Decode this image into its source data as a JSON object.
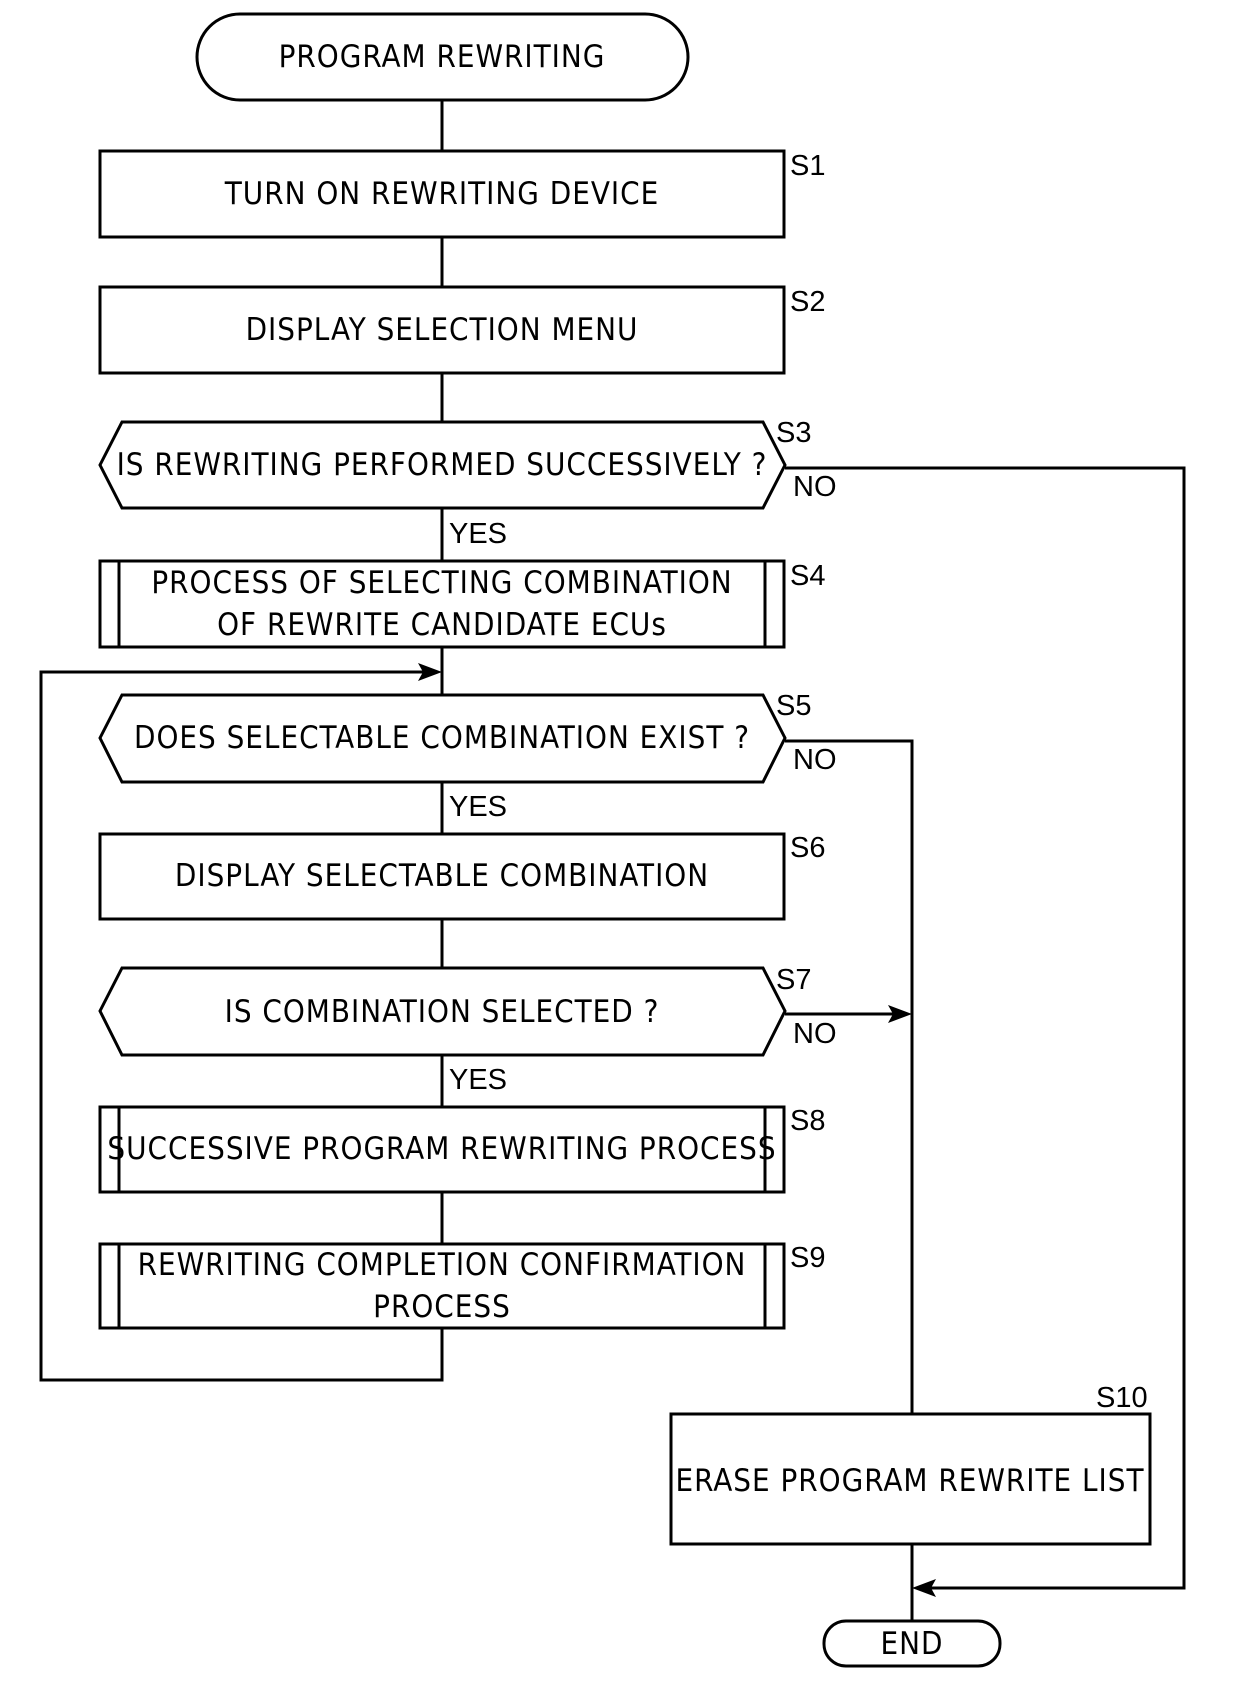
{
  "title": "PROGRAM REWRITING",
  "end_label": "END",
  "branch_labels": {
    "yes": "YES",
    "no": "NO"
  },
  "steps": {
    "s1": {
      "id": "S1",
      "text": "TURN ON REWRITING DEVICE",
      "type": "process"
    },
    "s2": {
      "id": "S2",
      "text": "DISPLAY SELECTION MENU",
      "type": "process"
    },
    "s3": {
      "id": "S3",
      "text": "IS REWRITING PERFORMED SUCCESSIVELY ?",
      "type": "decision"
    },
    "s4": {
      "id": "S4",
      "line1": "PROCESS OF SELECTING COMBINATION",
      "line2": "OF REWRITE CANDIDATE ECUs",
      "type": "subprocess"
    },
    "s5": {
      "id": "S5",
      "text": "DOES SELECTABLE COMBINATION EXIST ?",
      "type": "decision"
    },
    "s6": {
      "id": "S6",
      "text": "DISPLAY SELECTABLE COMBINATION",
      "type": "process"
    },
    "s7": {
      "id": "S7",
      "text": "IS COMBINATION SELECTED ?",
      "type": "decision"
    },
    "s8": {
      "id": "S8",
      "text": "SUCCESSIVE PROGRAM REWRITING PROCESS",
      "type": "subprocess"
    },
    "s9": {
      "id": "S9",
      "line1": "REWRITING COMPLETION CONFIRMATION",
      "line2": "PROCESS",
      "type": "subprocess"
    },
    "s10": {
      "id": "S10",
      "text": "ERASE PROGRAM REWRITE LIST",
      "type": "process"
    }
  }
}
